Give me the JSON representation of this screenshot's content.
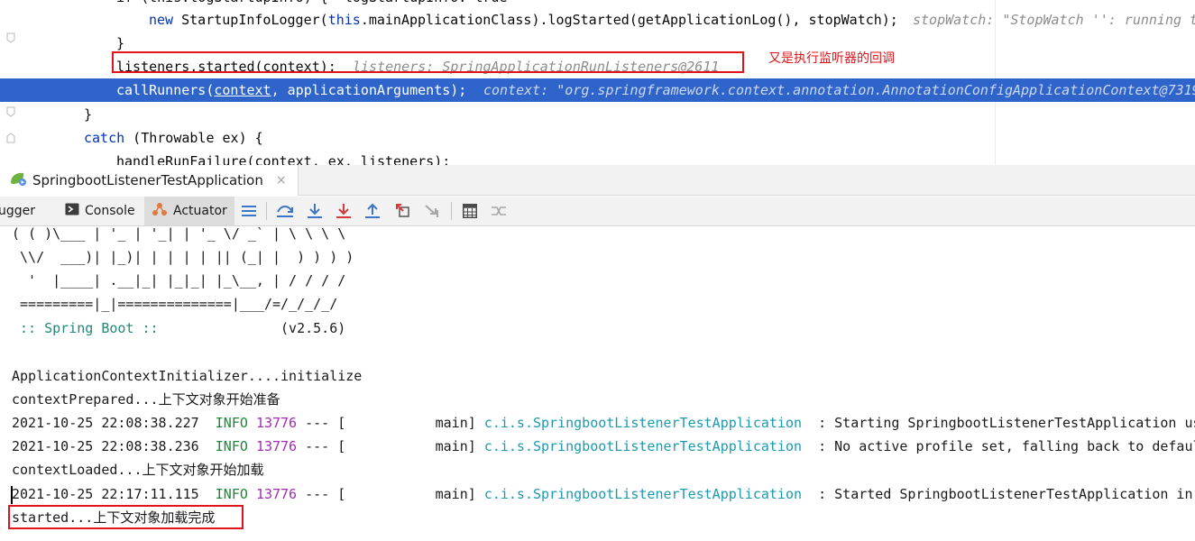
{
  "editor": {
    "line_partial": "if (this.logStartupInfo) {  logStartupInfo: true",
    "line_logger_new": "new",
    "line_logger_rest": " StartupInfoLogger(",
    "line_logger_this": "this",
    "line_logger_rest2": ".mainApplicationClass).logStarted(getApplicationLog(), stopWatch);",
    "line_logger_hint": "stopWatch: \"StopWatch '': running t",
    "line_close_brace": "}",
    "line_started_code": "listeners.started(context);",
    "line_started_hint": "listeners: SpringApplicationRunListeners@2611",
    "line_runners_code_a": "callRunners(",
    "line_runners_code_b": "context",
    "line_runners_code_c": ", applicationArguments);",
    "line_runners_hint": "context: \"org.springframework.context.annotation.AnnotationConfigApplicationContext@7319",
    "line_catch_brace": "}",
    "line_catch_kw": "catch",
    "line_catch_rest": " (Throwable ex) {",
    "line_failure": "handleRunFailure(context, ex, listeners);"
  },
  "annotation": "又是执行监听器的回调",
  "run_window": {
    "tab_title": "SpringbootListenerTestApplication",
    "tab_close": "×",
    "toolbar": {
      "debugger_label": "ugger",
      "console_label": "Console",
      "actuator_label": "Actuator"
    }
  },
  "console": {
    "banner": [
      "( ( )\\___ | '_ | '_| | '_ \\/ _` | \\ \\ \\ \\",
      " \\\\/  ___)| |_)| | | | | || (_| |  ) ) ) )",
      "  '  |____| .__|_| |_|_| |_\\__, | / / / /",
      " =========|_|==============|___/=/_/_/_/"
    ],
    "spring_boot_label": " :: Spring Boot :: ",
    "spring_boot_version": "              (v2.5.6)",
    "init_line": "ApplicationContextInitializer....initialize",
    "prepared_prefix": "contextPrepared...",
    "prepared_cjk": "上下文对象开始准备",
    "log_lines": [
      {
        "timestamp": "2021-10-25 22:08:38.227",
        "level": "INFO",
        "pid": "13776",
        "sep": " --- [",
        "thread": "           main]",
        "logger": "c.i.s.SpringbootListenerTestApplication",
        "message": "  : Starting SpringbootListenerTestApplication us"
      },
      {
        "timestamp": "2021-10-25 22:08:38.236",
        "level": "INFO",
        "pid": "13776",
        "sep": " --- [",
        "thread": "           main]",
        "logger": "c.i.s.SpringbootListenerTestApplication",
        "message": "  : No active profile set, falling back to defaul"
      },
      {
        "timestamp": "2021-10-25 22:17:11.115",
        "level": "INFO",
        "pid": "13776",
        "sep": " --- [",
        "thread": "           main]",
        "logger": "c.i.s.SpringbootListenerTestApplication",
        "message": "  : Started SpringbootListenerTestApplication in"
      }
    ],
    "loaded_prefix": "contextLoaded...",
    "loaded_cjk": "上下文对象开始加载",
    "started_prefix": "started...",
    "started_cjk": "上下文对象加载完成"
  },
  "colors": {
    "current_line": "#2f65ca",
    "annotation_red": "#e1141b",
    "keyword": "#0033b3",
    "spring_green": "#23877a",
    "log_pid": "#a32bb5",
    "log_logger": "#1b9ab0"
  },
  "icons": [
    "fold-marker-icon",
    "spring-boot-run-icon",
    "console-icon",
    "actuator-icon",
    "menu-icon",
    "show-execution-point-icon",
    "step-over-icon",
    "step-into-icon",
    "force-step-into-icon",
    "step-out-icon",
    "drop-frame-icon",
    "run-to-cursor-icon",
    "evaluate-expression-icon",
    "trace-icon"
  ]
}
